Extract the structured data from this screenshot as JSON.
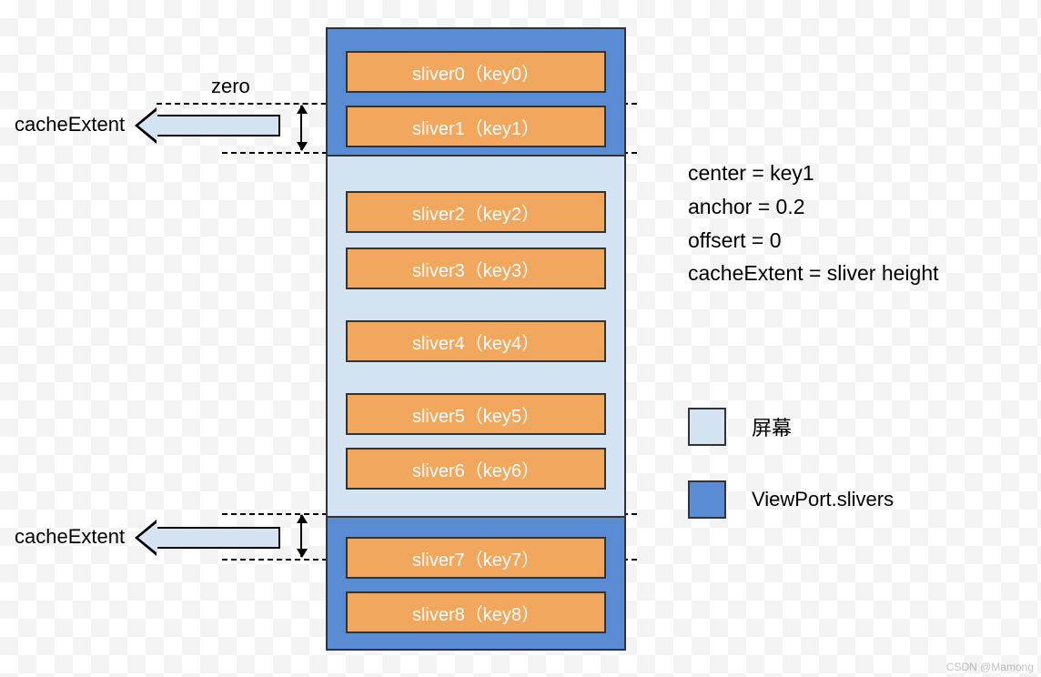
{
  "slivers": [
    {
      "label": "sliver0（key0）"
    },
    {
      "label": "sliver1（key1）"
    },
    {
      "label": "sliver2（key2）"
    },
    {
      "label": "sliver3（key3）"
    },
    {
      "label": "sliver4（key4）"
    },
    {
      "label": "sliver5（key5）"
    },
    {
      "label": "sliver6（key6）"
    },
    {
      "label": "sliver7（key7）"
    },
    {
      "label": "sliver8（key8）"
    }
  ],
  "annotations": {
    "zero": "zero",
    "cacheExtent": "cacheExtent"
  },
  "params": {
    "line1": "center = key1",
    "line2": "anchor = 0.2",
    "line3": "offsert = 0",
    "line4": "cacheExtent = sliver height"
  },
  "legend": {
    "screen": "屏幕",
    "viewport": "ViewPort.slivers"
  },
  "watermark": "CSDN @Mamong",
  "chart_data": {
    "type": "table",
    "description": "Flutter viewport layout diagram showing 9 slivers (sliver0..sliver8). sliver2..sliver6 are inside the visible screen region (light panel). sliver0 and sliver1 are above the screen (sliver1 within top cacheExtent). sliver7 and sliver8 are below the screen (sliver7 within bottom cacheExtent).",
    "parameters": {
      "center": "key1",
      "anchor": 0.2,
      "offset": 0,
      "cacheExtent": "sliver height"
    },
    "regions": {
      "above_cache": [
        "sliver0"
      ],
      "top_cacheExtent": [
        "sliver1"
      ],
      "visible_screen": [
        "sliver2",
        "sliver3",
        "sliver4",
        "sliver5",
        "sliver6"
      ],
      "bottom_cacheExtent": [
        "sliver7"
      ],
      "below_cache": [
        "sliver8"
      ]
    },
    "zero_line_at": "top of sliver1",
    "legend": {
      "light": "屏幕 (screen)",
      "dark": "ViewPort.slivers"
    }
  }
}
